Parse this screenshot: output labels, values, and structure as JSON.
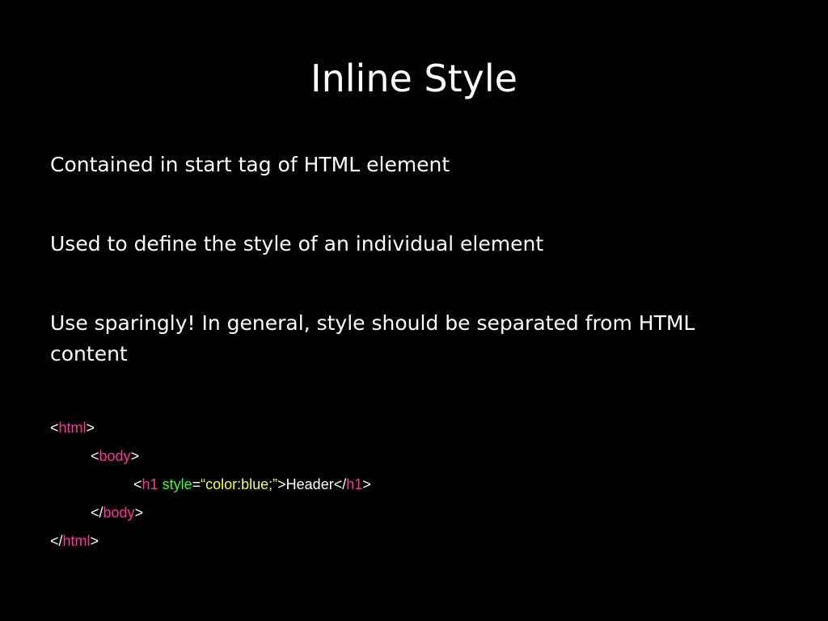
{
  "slide": {
    "title": "Inline Style",
    "bullets": [
      "Contained in start tag of HTML element",
      "Used to define the style of an individual element",
      "Use sparingly! In general, style should be separated from HTML content"
    ],
    "code": {
      "line1": {
        "open": "<",
        "tag": "html",
        "close": ">"
      },
      "line2": {
        "open": "<",
        "tag": "body",
        "close": ">"
      },
      "line3": {
        "open": "<",
        "tag": "h1",
        "space": " ",
        "attr": "style",
        "eq": "=",
        "value": "“color:blue;”",
        "gt": ">",
        "text": "Header",
        "end_open": "</",
        "end_tag": "h1",
        "end_close": ">"
      },
      "line4": {
        "open": "</",
        "tag": "body",
        "close": ">"
      },
      "line5": {
        "open": "</",
        "tag": "html",
        "close": ">"
      }
    },
    "colors": {
      "background": "#000000",
      "text": "#ffffff",
      "tag": "#ff3399",
      "attribute": "#33ff33",
      "value": "#ffff33"
    }
  }
}
